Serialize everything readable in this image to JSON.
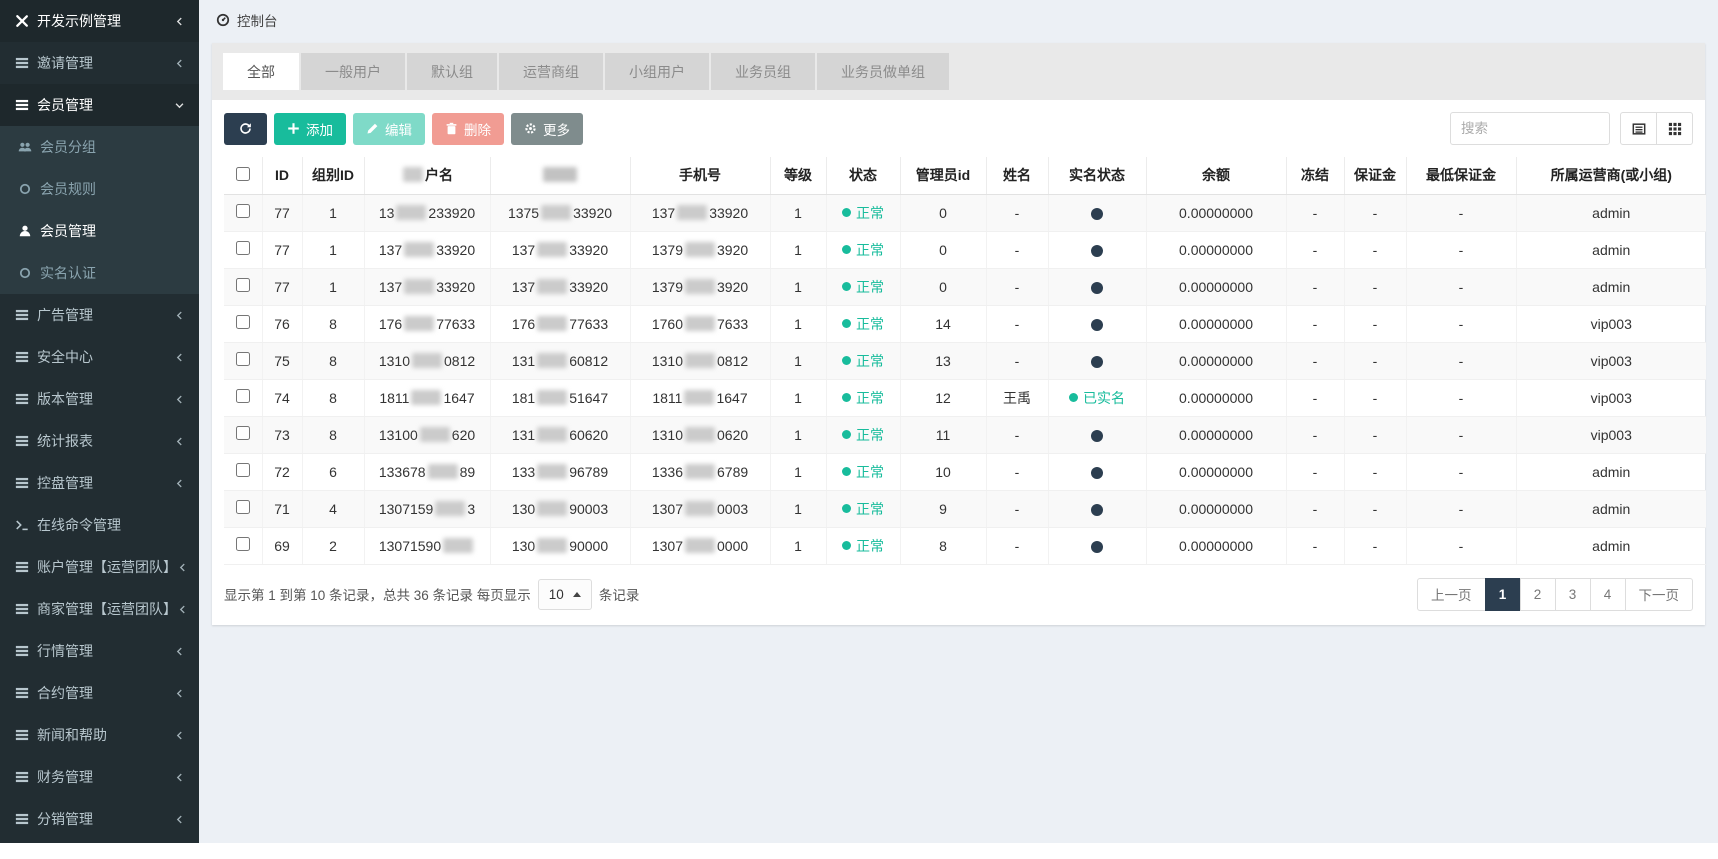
{
  "colors": {
    "sidebar_bg": "#222d32",
    "sidebar_submenu_bg": "#2c3b41",
    "content_bg": "#ecf0f5",
    "accent_teal": "#18bc9c",
    "navy": "#2c3e50",
    "danger": "#e74c3c",
    "gray_button": "#7f8c8d"
  },
  "breadcrumb": {
    "icon": "dashboard-icon",
    "label": "控制台"
  },
  "sidebar": {
    "items": [
      {
        "key": "dev-demo-management",
        "label": "开发示例管理",
        "icon": "wrench-icon",
        "chevron": "left",
        "highlight": true
      },
      {
        "key": "invite-management",
        "label": "邀请管理",
        "icon": "list-icon",
        "chevron": "left"
      },
      {
        "key": "member-management",
        "label": "会员管理",
        "icon": "list-icon",
        "chevron": "down",
        "open": true,
        "children": [
          {
            "key": "member-group",
            "label": "会员分组",
            "icon": "users-icon"
          },
          {
            "key": "member-rules",
            "label": "会员规则",
            "icon": "circle-icon"
          },
          {
            "key": "member-management-sub",
            "label": "会员管理",
            "icon": "user-icon",
            "active": true
          },
          {
            "key": "realname-auth",
            "label": "实名认证",
            "icon": "circle-icon"
          }
        ]
      },
      {
        "key": "ad-management",
        "label": "广告管理",
        "icon": "list-icon",
        "chevron": "left"
      },
      {
        "key": "security-center",
        "label": "安全中心",
        "icon": "list-icon",
        "chevron": "left"
      },
      {
        "key": "version-management",
        "label": "版本管理",
        "icon": "list-icon",
        "chevron": "left"
      },
      {
        "key": "stats-report",
        "label": "统计报表",
        "icon": "list-icon",
        "chevron": "left"
      },
      {
        "key": "market-control",
        "label": "控盘管理",
        "icon": "list-icon",
        "chevron": "left"
      },
      {
        "key": "online-command",
        "label": "在线命令管理",
        "icon": "terminal-icon",
        "chevron": null
      },
      {
        "key": "account-management-ops",
        "label": "账户管理【运营团队】",
        "icon": "list-icon",
        "chevron": "left"
      },
      {
        "key": "merchant-management-ops",
        "label": "商家管理【运营团队】",
        "icon": "list-icon",
        "chevron": "left"
      },
      {
        "key": "quotes-management",
        "label": "行情管理",
        "icon": "list-icon",
        "chevron": "left"
      },
      {
        "key": "contract-management",
        "label": "合约管理",
        "icon": "list-icon",
        "chevron": "left"
      },
      {
        "key": "news-help",
        "label": "新闻和帮助",
        "icon": "list-icon",
        "chevron": "left"
      },
      {
        "key": "finance-management",
        "label": "财务管理",
        "icon": "list-icon",
        "chevron": "left"
      },
      {
        "key": "distribution-management",
        "label": "分销管理",
        "icon": "list-icon",
        "chevron": "left"
      }
    ]
  },
  "tabs": {
    "active_index": 0,
    "items": [
      {
        "key": "all",
        "label": "全部"
      },
      {
        "key": "general-user",
        "label": "一般用户"
      },
      {
        "key": "default-group",
        "label": "默认组"
      },
      {
        "key": "operator-group",
        "label": "运营商组"
      },
      {
        "key": "team-user",
        "label": "小组用户"
      },
      {
        "key": "salesman-group",
        "label": "业务员组"
      },
      {
        "key": "salesman-order-group",
        "label": "业务员做单组"
      }
    ]
  },
  "toolbar": {
    "refresh_icon": "refresh-icon",
    "add_label": "添加",
    "edit_label": "编辑",
    "delete_label": "删除",
    "more_label": "更多",
    "search_placeholder": "搜索"
  },
  "table": {
    "columns": [
      {
        "name": "select",
        "label": "",
        "header": "checkbox"
      },
      {
        "name": "id",
        "label": "ID"
      },
      {
        "name": "group-id",
        "label": "组别ID"
      },
      {
        "name": "username",
        "label": "户名",
        "header_redact": "before"
      },
      {
        "name": "hidden",
        "label": "",
        "header_redact": "full"
      },
      {
        "name": "phone",
        "label": "手机号"
      },
      {
        "name": "level",
        "label": "等级"
      },
      {
        "name": "status",
        "label": "状态"
      },
      {
        "name": "admin-id",
        "label": "管理员id"
      },
      {
        "name": "name",
        "label": "姓名"
      },
      {
        "name": "realname-status",
        "label": "实名状态"
      },
      {
        "name": "balance",
        "label": "余额"
      },
      {
        "name": "frozen",
        "label": "冻结"
      },
      {
        "name": "margin",
        "label": "保证金"
      },
      {
        "name": "min-margin",
        "label": "最低保证金"
      },
      {
        "name": "operator",
        "label": "所属运营商(或小组)"
      }
    ],
    "status_normal": "正常",
    "realname_verified_label": "已实名",
    "rows": [
      {
        "id": "77",
        "gid": "1",
        "username": [
          "13",
          "233920"
        ],
        "hidden": [
          "1375",
          "33920"
        ],
        "phone": [
          "137",
          "33920"
        ],
        "level": "1",
        "status": "正常",
        "admin_id": "0",
        "name": "-",
        "realname": {
          "verified": false,
          "label": ""
        },
        "balance": "0.00000000",
        "frozen": "-",
        "margin": "-",
        "min_margin": "-",
        "operator": "admin"
      },
      {
        "id": "77",
        "gid": "1",
        "username": [
          "137",
          "33920"
        ],
        "hidden": [
          "137",
          "33920"
        ],
        "phone": [
          "1379",
          "3920"
        ],
        "level": "1",
        "status": "正常",
        "admin_id": "0",
        "name": "-",
        "realname": {
          "verified": false,
          "label": ""
        },
        "balance": "0.00000000",
        "frozen": "-",
        "margin": "-",
        "min_margin": "-",
        "operator": "admin"
      },
      {
        "id": "77",
        "gid": "1",
        "username": [
          "137",
          "33920"
        ],
        "hidden": [
          "137",
          "33920"
        ],
        "phone": [
          "1379",
          "3920"
        ],
        "level": "1",
        "status": "正常",
        "admin_id": "0",
        "name": "-",
        "realname": {
          "verified": false,
          "label": ""
        },
        "balance": "0.00000000",
        "frozen": "-",
        "margin": "-",
        "min_margin": "-",
        "operator": "admin"
      },
      {
        "id": "76",
        "gid": "8",
        "username": [
          "176",
          "77633"
        ],
        "hidden": [
          "176",
          "77633"
        ],
        "phone": [
          "1760",
          "7633"
        ],
        "level": "1",
        "status": "正常",
        "admin_id": "14",
        "name": "-",
        "realname": {
          "verified": false,
          "label": ""
        },
        "balance": "0.00000000",
        "frozen": "-",
        "margin": "-",
        "min_margin": "-",
        "operator": "vip003"
      },
      {
        "id": "75",
        "gid": "8",
        "username": [
          "1310",
          "0812"
        ],
        "hidden": [
          "131",
          "60812"
        ],
        "phone": [
          "1310",
          "0812"
        ],
        "level": "1",
        "status": "正常",
        "admin_id": "13",
        "name": "-",
        "realname": {
          "verified": false,
          "label": ""
        },
        "balance": "0.00000000",
        "frozen": "-",
        "margin": "-",
        "min_margin": "-",
        "operator": "vip003"
      },
      {
        "id": "74",
        "gid": "8",
        "username": [
          "1811",
          "1647"
        ],
        "hidden": [
          "181",
          "51647"
        ],
        "phone": [
          "1811",
          "1647"
        ],
        "level": "1",
        "status": "正常",
        "admin_id": "12",
        "name": "王禹",
        "realname": {
          "verified": true,
          "label": "已实名"
        },
        "balance": "0.00000000",
        "frozen": "-",
        "margin": "-",
        "min_margin": "-",
        "operator": "vip003"
      },
      {
        "id": "73",
        "gid": "8",
        "username": [
          "13100",
          "620"
        ],
        "hidden": [
          "131",
          "60620"
        ],
        "phone": [
          "1310",
          "0620"
        ],
        "level": "1",
        "status": "正常",
        "admin_id": "11",
        "name": "-",
        "realname": {
          "verified": false,
          "label": ""
        },
        "balance": "0.00000000",
        "frozen": "-",
        "margin": "-",
        "min_margin": "-",
        "operator": "vip003"
      },
      {
        "id": "72",
        "gid": "6",
        "username": [
          "133678",
          "89"
        ],
        "hidden": [
          "133",
          "96789"
        ],
        "phone": [
          "1336",
          "6789"
        ],
        "level": "1",
        "status": "正常",
        "admin_id": "10",
        "name": "-",
        "realname": {
          "verified": false,
          "label": ""
        },
        "balance": "0.00000000",
        "frozen": "-",
        "margin": "-",
        "min_margin": "-",
        "operator": "admin"
      },
      {
        "id": "71",
        "gid": "4",
        "username": [
          "1307159",
          "3"
        ],
        "hidden": [
          "130",
          "90003"
        ],
        "phone": [
          "1307",
          "0003"
        ],
        "level": "1",
        "status": "正常",
        "admin_id": "9",
        "name": "-",
        "realname": {
          "verified": false,
          "label": ""
        },
        "balance": "0.00000000",
        "frozen": "-",
        "margin": "-",
        "min_margin": "-",
        "operator": "admin"
      },
      {
        "id": "69",
        "gid": "2",
        "username": [
          "13071590",
          ""
        ],
        "hidden": [
          "130",
          "90000"
        ],
        "phone": [
          "1307",
          "0000"
        ],
        "level": "1",
        "status": "正常",
        "admin_id": "8",
        "name": "-",
        "realname": {
          "verified": false,
          "label": ""
        },
        "balance": "0.00000000",
        "frozen": "-",
        "margin": "-",
        "min_margin": "-",
        "operator": "admin"
      }
    ]
  },
  "pagination": {
    "info_prefix": "显示第 1 到第 10 条记录，总共 36 条记录 每页显示",
    "page_size": "10",
    "info_suffix": "条记录",
    "prev": "上一页",
    "next": "下一页",
    "pages": [
      "1",
      "2",
      "3",
      "4"
    ],
    "active_page": "1"
  }
}
